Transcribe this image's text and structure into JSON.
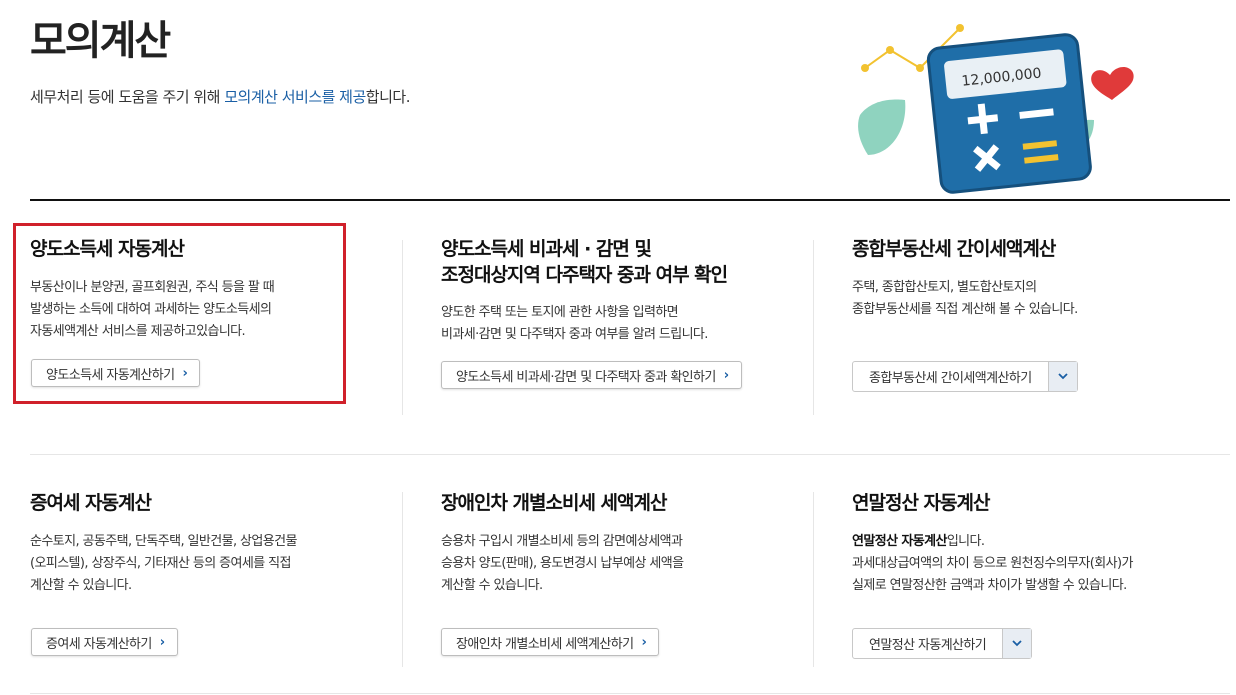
{
  "header": {
    "title": "모의계산",
    "subtitle_prefix": "세무처리 등에 도움을 주기 위해 ",
    "subtitle_highlight": "모의계산 서비스를 제공",
    "subtitle_suffix": "합니다.",
    "illustration_amount": "12,000,000"
  },
  "cards": [
    {
      "title": "양도소득세 자동계산",
      "desc_lines": [
        "부동산이나 분양권, 골프회원권, 주식 등을 팔 때",
        "발생하는 소득에 대하여 과세하는 양도소득세의",
        "자동세액계산 서비스를 제공하고있습니다."
      ],
      "button_label": "양도소득세 자동계산하기"
    },
    {
      "title_lines": [
        "양도소득세 비과세 · 감면 및",
        "조정대상지역 다주택자 중과 여부 확인"
      ],
      "desc_lines": [
        "양도한 주택 또는 토지에 관한 사항을 입력하면",
        "비과세·감면 및 다주택자 중과 여부를 알려 드립니다."
      ],
      "button_label": "양도소득세 비과세·감면 및 다주택자 중과 확인하기"
    },
    {
      "title": "종합부동산세 간이세액계산",
      "desc_lines": [
        "주택, 종합합산토지, 별도합산토지의",
        "종합부동산세를 직접 계산해 볼 수 있습니다."
      ],
      "select_value": "종합부동산세 간이세액계산하기"
    },
    {
      "title": "증여세 자동계산",
      "desc_lines": [
        "순수토지, 공동주택, 단독주택, 일반건물, 상업용건물",
        "(오피스텔), 상장주식, 기타재산 등의 증여세를 직접",
        "계산할 수 있습니다."
      ],
      "button_label": "증여세 자동계산하기"
    },
    {
      "title": "장애인차 개별소비세 세액계산",
      "desc_lines": [
        "승용차 구입시 개별소비세 등의 감면예상세액과",
        "승용차 양도(판매), 용도변경시 납부예상 세액을",
        "계산할 수 있습니다."
      ],
      "button_label": "장애인차 개별소비세 세액계산하기"
    },
    {
      "title": "연말정산 자동계산",
      "desc_bold": "연말정산 자동계산",
      "desc_bold_suffix": "입니다.",
      "desc_lines": [
        "과세대상급여액의 차이 등으로 원천징수의무자(회사)가",
        "실제로 연말정산한 금액과 차이가 발생할 수 있습니다."
      ],
      "select_value": "연말정산 자동계산하기"
    }
  ],
  "icons": {
    "button_chevron": "chevron-right-icon",
    "select_arrow": "chevron-down-icon"
  },
  "colors": {
    "accent": "#1a5fa5",
    "highlight_border": "#d0202a"
  }
}
